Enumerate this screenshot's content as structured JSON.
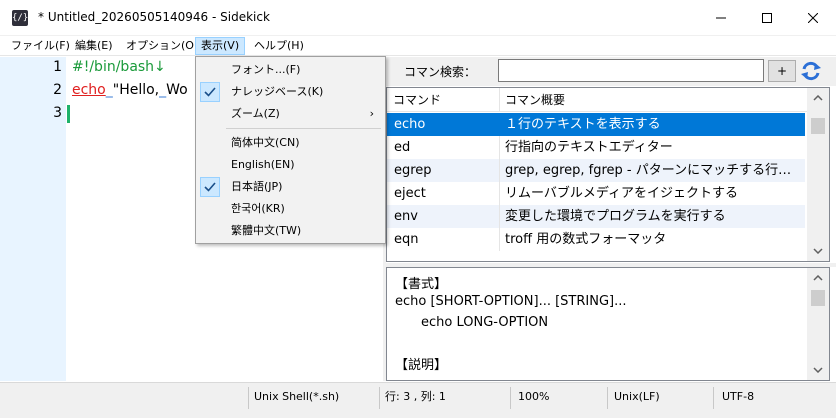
{
  "window": {
    "app_icon_text": "{/}",
    "title": "* Untitled_20260505140946  -  Sidekick"
  },
  "menubar": {
    "items": [
      "ファイル(F)",
      "編集(E)",
      "オプション(O)",
      "表示(V)",
      "ヘルプ(H)"
    ],
    "active": "表示(V)"
  },
  "view_menu": {
    "items": [
      {
        "label": "フォント...(F)",
        "checked": false
      },
      {
        "label": "ナレッジベース(K)",
        "checked": true
      },
      {
        "label": "ズーム(Z)",
        "submenu": true,
        "arrow": "›"
      },
      {
        "label": "简体中文(CN)",
        "checked": false
      },
      {
        "label": "English(EN)",
        "checked": false
      },
      {
        "label": "日本語(JP)",
        "checked": true
      },
      {
        "label": "한국어(KR)",
        "checked": false
      },
      {
        "label": "繁體中文(TW)",
        "checked": false
      }
    ]
  },
  "editor": {
    "line_numbers": [
      "1",
      "2",
      "3"
    ],
    "line1": "#!/bin/bash↓",
    "line2_keyword": "echo",
    "line2_space": "_",
    "line2_rest": "\"Hello,",
    "line2_space2": "_",
    "line2_tail": "Wo"
  },
  "search": {
    "label": "コマン検索：",
    "value": "",
    "add_label": "+"
  },
  "command_table": {
    "headers": [
      "コマンド",
      "コマン概要"
    ],
    "rows": [
      {
        "cmd": "echo",
        "desc": "１行のテキストを表示する",
        "selected": true
      },
      {
        "cmd": "ed",
        "desc": "行指向のテキストエディター"
      },
      {
        "cmd": "egrep",
        "desc": "grep, egrep, fgrep - パターンにマッチする行を..."
      },
      {
        "cmd": "eject",
        "desc": "リムーバブルメディアをイジェクトする"
      },
      {
        "cmd": "env",
        "desc": "変更した環境でプログラムを実行する"
      },
      {
        "cmd": "eqn",
        "desc": "troff 用の数式フォーマッタ"
      }
    ]
  },
  "detail": {
    "lines": [
      "【書式】",
      "echo [SHORT-OPTION]... [STRING]...",
      "echo LONG-OPTION",
      "",
      "【説明】"
    ]
  },
  "statusbar": {
    "language": "Unix Shell(*.sh)",
    "position": "行: 3 ,  列: 1",
    "zoom": "100%",
    "line_ending": "Unix(LF)",
    "encoding": "UTF-8"
  },
  "colors": {
    "gutter": "#e8f4ff",
    "selection": "#0078d7",
    "accent": "#3a7bd5"
  }
}
